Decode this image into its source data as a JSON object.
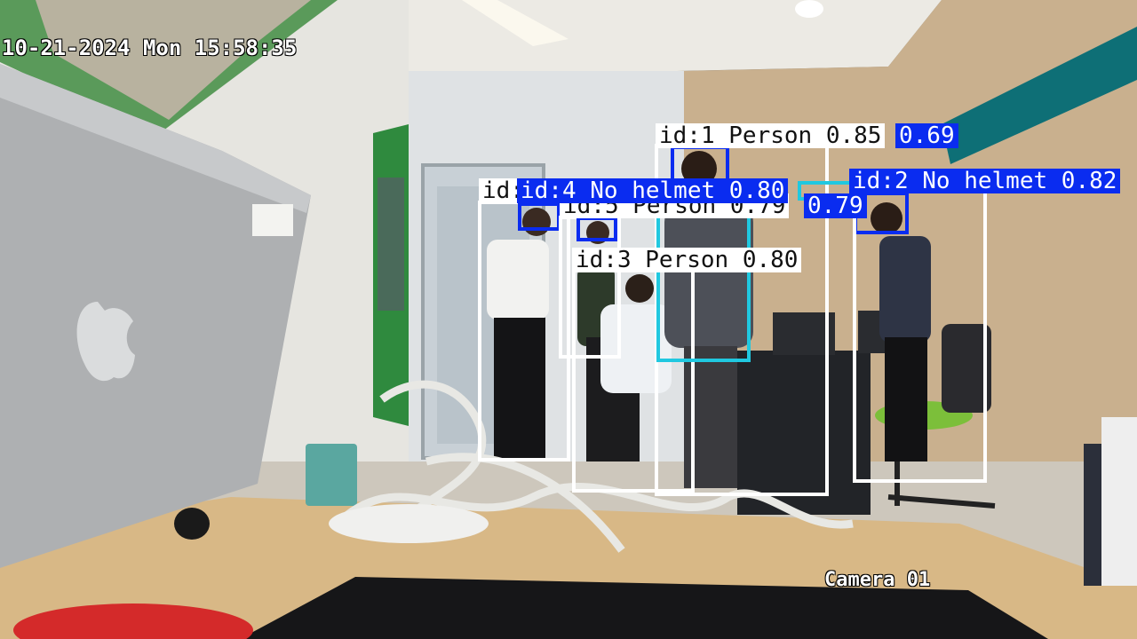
{
  "overlay": {
    "timestamp": "10-21-2024 Mon 15:58:35",
    "camera_label": "Camera 01"
  },
  "colors": {
    "person_box": "#ffffff",
    "no_helmet_box": "#0a2cf0",
    "cyan_box": "#20c8e0",
    "label_person_bg": "#ffffff",
    "label_no_helmet_bg": "#0a2cf0"
  },
  "detections": [
    {
      "id_label": "id:1 Person 0.85",
      "extra": "0.69"
    },
    {
      "id_label": "id:2 No helmet 0.82"
    },
    {
      "id_label": "id:3 Person 0.80"
    },
    {
      "id_label": "id:4 No helmet 0.80",
      "prefix": "id:"
    },
    {
      "id_label": "id:5 Person 0.79",
      "extra": "0.79"
    }
  ]
}
